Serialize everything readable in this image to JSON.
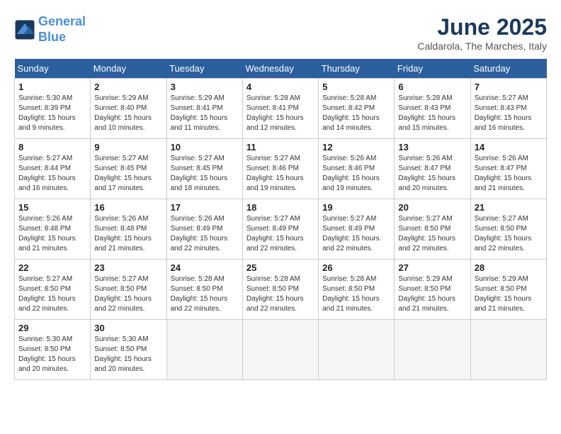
{
  "header": {
    "logo_line1": "General",
    "logo_line2": "Blue",
    "month": "June 2025",
    "location": "Caldarola, The Marches, Italy"
  },
  "days_of_week": [
    "Sunday",
    "Monday",
    "Tuesday",
    "Wednesday",
    "Thursday",
    "Friday",
    "Saturday"
  ],
  "weeks": [
    [
      {
        "day": "1",
        "info": "Sunrise: 5:30 AM\nSunset: 8:39 PM\nDaylight: 15 hours\nand 9 minutes."
      },
      {
        "day": "2",
        "info": "Sunrise: 5:29 AM\nSunset: 8:40 PM\nDaylight: 15 hours\nand 10 minutes."
      },
      {
        "day": "3",
        "info": "Sunrise: 5:29 AM\nSunset: 8:41 PM\nDaylight: 15 hours\nand 11 minutes."
      },
      {
        "day": "4",
        "info": "Sunrise: 5:28 AM\nSunset: 8:41 PM\nDaylight: 15 hours\nand 12 minutes."
      },
      {
        "day": "5",
        "info": "Sunrise: 5:28 AM\nSunset: 8:42 PM\nDaylight: 15 hours\nand 14 minutes."
      },
      {
        "day": "6",
        "info": "Sunrise: 5:28 AM\nSunset: 8:43 PM\nDaylight: 15 hours\nand 15 minutes."
      },
      {
        "day": "7",
        "info": "Sunrise: 5:27 AM\nSunset: 8:43 PM\nDaylight: 15 hours\nand 16 minutes."
      }
    ],
    [
      {
        "day": "8",
        "info": "Sunrise: 5:27 AM\nSunset: 8:44 PM\nDaylight: 15 hours\nand 16 minutes."
      },
      {
        "day": "9",
        "info": "Sunrise: 5:27 AM\nSunset: 8:45 PM\nDaylight: 15 hours\nand 17 minutes."
      },
      {
        "day": "10",
        "info": "Sunrise: 5:27 AM\nSunset: 8:45 PM\nDaylight: 15 hours\nand 18 minutes."
      },
      {
        "day": "11",
        "info": "Sunrise: 5:27 AM\nSunset: 8:46 PM\nDaylight: 15 hours\nand 19 minutes."
      },
      {
        "day": "12",
        "info": "Sunrise: 5:26 AM\nSunset: 8:46 PM\nDaylight: 15 hours\nand 19 minutes."
      },
      {
        "day": "13",
        "info": "Sunrise: 5:26 AM\nSunset: 8:47 PM\nDaylight: 15 hours\nand 20 minutes."
      },
      {
        "day": "14",
        "info": "Sunrise: 5:26 AM\nSunset: 8:47 PM\nDaylight: 15 hours\nand 21 minutes."
      }
    ],
    [
      {
        "day": "15",
        "info": "Sunrise: 5:26 AM\nSunset: 8:48 PM\nDaylight: 15 hours\nand 21 minutes."
      },
      {
        "day": "16",
        "info": "Sunrise: 5:26 AM\nSunset: 8:48 PM\nDaylight: 15 hours\nand 21 minutes."
      },
      {
        "day": "17",
        "info": "Sunrise: 5:26 AM\nSunset: 8:49 PM\nDaylight: 15 hours\nand 22 minutes."
      },
      {
        "day": "18",
        "info": "Sunrise: 5:27 AM\nSunset: 8:49 PM\nDaylight: 15 hours\nand 22 minutes."
      },
      {
        "day": "19",
        "info": "Sunrise: 5:27 AM\nSunset: 8:49 PM\nDaylight: 15 hours\nand 22 minutes."
      },
      {
        "day": "20",
        "info": "Sunrise: 5:27 AM\nSunset: 8:50 PM\nDaylight: 15 hours\nand 22 minutes."
      },
      {
        "day": "21",
        "info": "Sunrise: 5:27 AM\nSunset: 8:50 PM\nDaylight: 15 hours\nand 22 minutes."
      }
    ],
    [
      {
        "day": "22",
        "info": "Sunrise: 5:27 AM\nSunset: 8:50 PM\nDaylight: 15 hours\nand 22 minutes."
      },
      {
        "day": "23",
        "info": "Sunrise: 5:27 AM\nSunset: 8:50 PM\nDaylight: 15 hours\nand 22 minutes."
      },
      {
        "day": "24",
        "info": "Sunrise: 5:28 AM\nSunset: 8:50 PM\nDaylight: 15 hours\nand 22 minutes."
      },
      {
        "day": "25",
        "info": "Sunrise: 5:28 AM\nSunset: 8:50 PM\nDaylight: 15 hours\nand 22 minutes."
      },
      {
        "day": "26",
        "info": "Sunrise: 5:28 AM\nSunset: 8:50 PM\nDaylight: 15 hours\nand 21 minutes."
      },
      {
        "day": "27",
        "info": "Sunrise: 5:29 AM\nSunset: 8:50 PM\nDaylight: 15 hours\nand 21 minutes."
      },
      {
        "day": "28",
        "info": "Sunrise: 5:29 AM\nSunset: 8:50 PM\nDaylight: 15 hours\nand 21 minutes."
      }
    ],
    [
      {
        "day": "29",
        "info": "Sunrise: 5:30 AM\nSunset: 8:50 PM\nDaylight: 15 hours\nand 20 minutes."
      },
      {
        "day": "30",
        "info": "Sunrise: 5:30 AM\nSunset: 8:50 PM\nDaylight: 15 hours\nand 20 minutes."
      },
      null,
      null,
      null,
      null,
      null
    ]
  ]
}
